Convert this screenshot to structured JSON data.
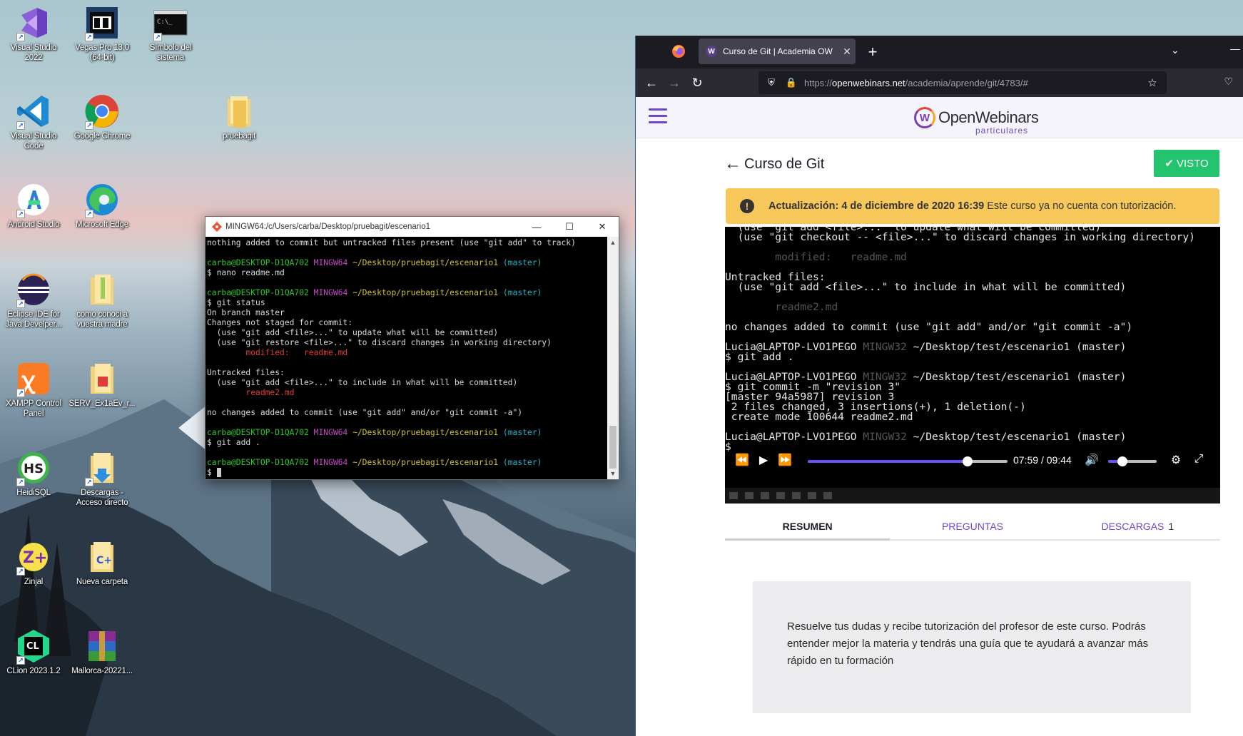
{
  "desktop": {
    "icons": [
      {
        "label": "Visual Studio 2022"
      },
      {
        "label": "Vegas Pro 13.0 (64-bit)"
      },
      {
        "label": "Símbolo del sistema"
      },
      {
        "label": "Visual Studio Code"
      },
      {
        "label": "Google Chrome"
      },
      {
        "label": "pruebagit"
      },
      {
        "label": "Android Studio"
      },
      {
        "label": "Microsoft Edge"
      },
      {
        "label": "Eclipse IDE for Java Develper..."
      },
      {
        "label": "como conoci a vuestra madre"
      },
      {
        "label": "XAMPP Control Panel"
      },
      {
        "label": "SERV_Ex1aEv_r..."
      },
      {
        "label": "HeidiSQL"
      },
      {
        "label": "Descargas - Acceso directo"
      },
      {
        "label": "Zinjal"
      },
      {
        "label": "Nueva carpeta"
      },
      {
        "label": "CLion 2023.1.2"
      },
      {
        "label": "Mallorca-20221..."
      }
    ]
  },
  "terminal": {
    "title": "MINGW64:/c/Users/carba/Desktop/pruebagit/escenario1",
    "line_untracked_top": "nothing added to commit but untracked files present (use \"git add\" to track)",
    "prompt_user": "carba@DESKTOP-D1QA702",
    "prompt_shell": "MINGW64",
    "prompt_path": "~/Desktop/pruebagit/escenario1",
    "prompt_branch": "(master)",
    "cmd_nano": "$ nano readme.md",
    "cmd_status": "$ git status",
    "on_branch": "On branch master",
    "changes_not_staged": "Changes not staged for commit:",
    "hint_add": "  (use \"git add <file>...\" to update what will be committed)",
    "hint_restore": "  (use \"git restore <file>...\" to discard changes in working directory)",
    "modified_line": "        modified:   readme.md",
    "untracked_files": "Untracked files:",
    "hint_include": "  (use \"git add <file>...\" to include in what will be committed)",
    "untracked_file": "        readme2.md",
    "no_changes": "no changes added to commit (use \"git add\" and/or \"git commit -a\")",
    "cmd_add": "$ git add .",
    "cursor_prompt": "$ "
  },
  "browser": {
    "tab_title": "Curso de Git | Academia OW",
    "url_prefix": "https://",
    "url_domain": "openwebinars.net",
    "url_path": "/academia/aprende/git/4783/#",
    "logo_name": "OpenWebinars",
    "logo_sub": "particulares",
    "course_title": "Curso de Git",
    "visto_label": "VISTO",
    "notice_bold": "Actualización: 4 de diciembre de 2020 16:39",
    "notice_text": "Este curso ya no cuenta con tutorización.",
    "video_lines": {
      "l1": "  (use \"git add <file>...\" to update what will be committed)",
      "l2": "  (use \"git checkout -- <file>...\" to discard changes in working directory)",
      "l3": "        modified:   readme.md",
      "l4": "Untracked files:",
      "l5": "  (use \"git add <file>...\" to include in what will be committed)",
      "l6": "        readme2.md",
      "l7": "no changes added to commit (use \"git add\" and/or \"git commit -a\")",
      "p_user": "Lucia@LAPTOP-LVO1PEGO",
      "p_shell": "MINGW32",
      "p_path": "~/Desktop/test/escenario1",
      "p_branch": "(master)",
      "c1": "$ git add .",
      "c2": "$ git commit -m \"revision 3\"",
      "o1": "[master 94a5987] revision 3",
      "o2": " 2 files changed, 3 insertions(+), 1 deletion(-)",
      "o3": " create mode 100644 readme2.md",
      "c3": "$"
    },
    "video_time_current": "07:59",
    "video_time_sep": "/",
    "video_time_total": "09:44",
    "video_progress": 0.8,
    "video_volume": 0.3,
    "tabs": [
      {
        "label": "RESUMEN"
      },
      {
        "label": "PREGUNTAS"
      },
      {
        "label": "DESCARGAS",
        "count": "1"
      }
    ],
    "tutor_text": "Resuelve tus dudas y recibe tutorización del profesor de este curso. Podrás entender mejor la materia y tendrás una guía que te ayudará a avanzar más rápido en tu formación"
  },
  "colors": {
    "accent": "#6c47c7",
    "visto_green": "#23c46d",
    "notice_yellow": "#f7c75a",
    "progress": "#6c4ff7"
  }
}
